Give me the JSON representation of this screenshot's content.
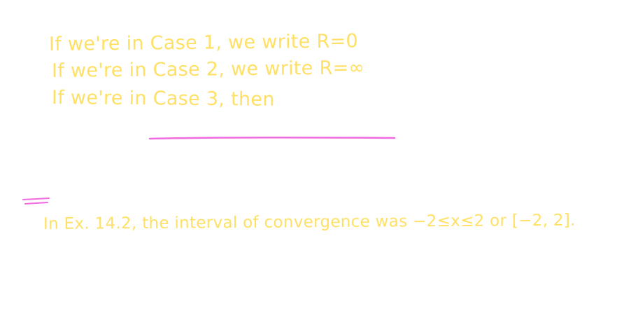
{
  "notes": {
    "line1": "If we're in Case 1, we write R=0",
    "line2": "If we're in Case 2, we write R=∞",
    "line3": "If we're in Case 3, then",
    "line4": "In Ex. 14.2, the interval of convergence was −2≤x≤2 or [−2, 2]."
  },
  "colors": {
    "yellow_ink": "#ffe066",
    "pink_ink": "#f06be0"
  }
}
